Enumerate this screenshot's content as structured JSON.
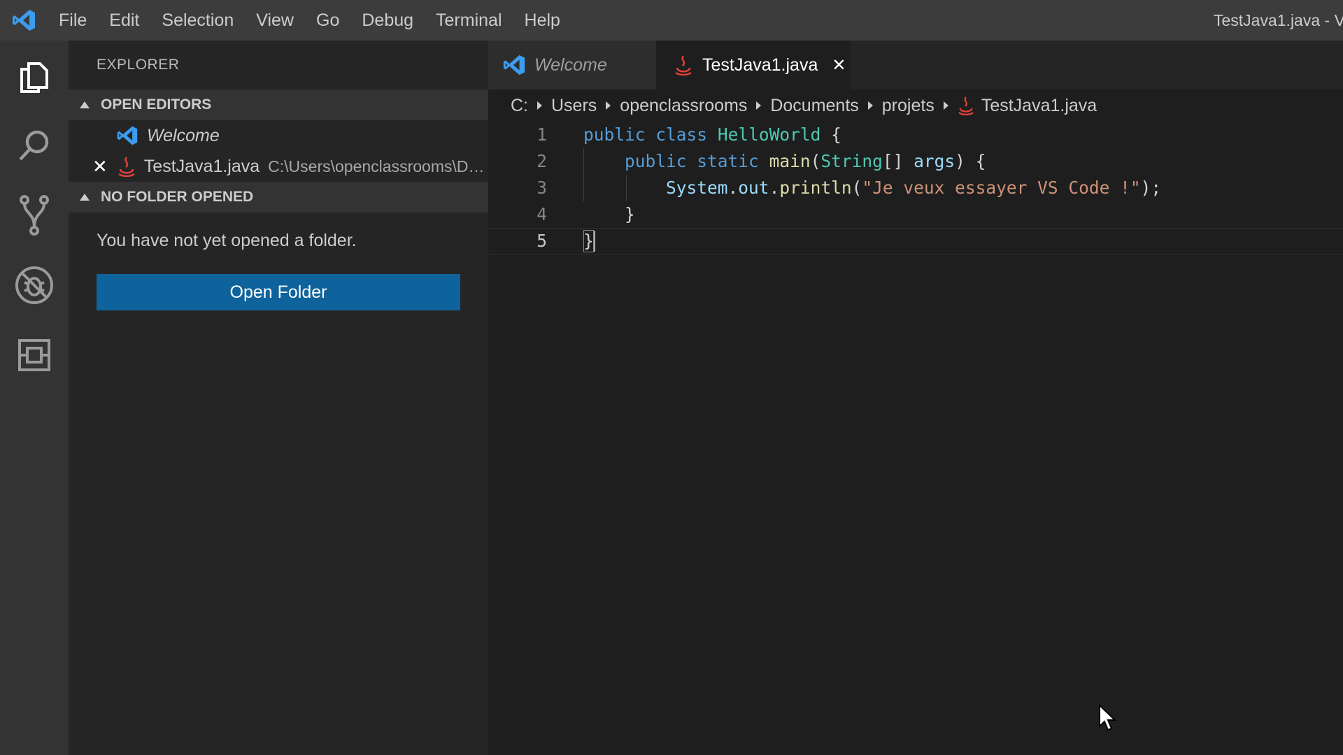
{
  "titlebar": {
    "menu": [
      "File",
      "Edit",
      "Selection",
      "View",
      "Go",
      "Debug",
      "Terminal",
      "Help"
    ],
    "window_title": "TestJava1.java - V"
  },
  "activitybar": {
    "icons": [
      "explorer-icon",
      "search-icon",
      "source-control-icon",
      "debug-icon",
      "extensions-icon"
    ]
  },
  "sidebar": {
    "title": "EXPLORER",
    "open_editors": {
      "header": "OPEN EDITORS",
      "items": [
        {
          "name": "Welcome",
          "path": ""
        },
        {
          "name": "TestJava1.java",
          "path": "C:\\Users\\openclassrooms\\Do..."
        }
      ]
    },
    "no_folder": {
      "header": "NO FOLDER OPENED",
      "message": "You have not yet opened a folder.",
      "button": "Open Folder"
    }
  },
  "editor": {
    "tabs": [
      {
        "label": "Welcome",
        "active": false
      },
      {
        "label": "TestJava1.java",
        "active": true
      }
    ],
    "breadcrumb": [
      "C:",
      "Users",
      "openclassrooms",
      "Documents",
      "projets",
      "TestJava1.java"
    ],
    "lines": [
      {
        "no": "1",
        "tokens": [
          [
            "kw",
            "public"
          ],
          [
            "p",
            " "
          ],
          [
            "kw",
            "class"
          ],
          [
            "p",
            " "
          ],
          [
            "cls",
            "HelloWorld"
          ],
          [
            "p",
            " {"
          ]
        ]
      },
      {
        "no": "2",
        "tokens": [
          [
            "p",
            "    "
          ],
          [
            "kw",
            "public"
          ],
          [
            "p",
            " "
          ],
          [
            "kw",
            "static"
          ],
          [
            "p",
            " "
          ],
          [
            "fn",
            "main"
          ],
          [
            "p",
            "("
          ],
          [
            "cls",
            "String"
          ],
          [
            "p",
            "[] "
          ],
          [
            "var",
            "args"
          ],
          [
            "p",
            ") {"
          ]
        ]
      },
      {
        "no": "3",
        "tokens": [
          [
            "p",
            "        "
          ],
          [
            "var",
            "System"
          ],
          [
            "p",
            "."
          ],
          [
            "var",
            "out"
          ],
          [
            "p",
            "."
          ],
          [
            "fn",
            "println"
          ],
          [
            "p",
            "("
          ],
          [
            "str",
            "\"Je veux essayer VS Code !\""
          ],
          [
            "p",
            ");"
          ]
        ]
      },
      {
        "no": "4",
        "tokens": [
          [
            "p",
            "    }"
          ]
        ]
      },
      {
        "no": "5",
        "tokens": [
          [
            "p",
            "}"
          ]
        ]
      }
    ]
  },
  "colors": {
    "accent_button": "#0e639c",
    "java_icon": "#e2413a",
    "vscode_blue": "#3b9cf0"
  }
}
